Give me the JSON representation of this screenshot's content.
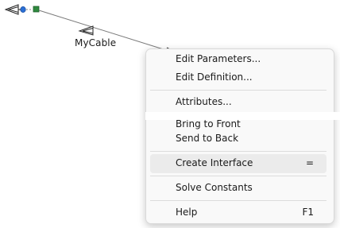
{
  "cable": {
    "label": "MyCable"
  },
  "menu": {
    "items": [
      {
        "label": "Edit Parameters...",
        "shortcut": ""
      },
      {
        "label": "Edit Definition...",
        "shortcut": ""
      },
      {
        "label": "Attributes...",
        "shortcut": ""
      },
      {
        "label": "Bring to Front",
        "shortcut": ""
      },
      {
        "label": "Send to Back",
        "shortcut": ""
      },
      {
        "label": "Create Interface",
        "shortcut": "="
      },
      {
        "label": "Solve Constants",
        "shortcut": ""
      },
      {
        "label": "Help",
        "shortcut": "F1"
      }
    ],
    "highlighted_item": "Create Interface"
  },
  "colors": {
    "menu_background": "#f9f9f9",
    "highlight": "#ebebeb",
    "port_blue": "#2b6fd6",
    "port_green": "#2f8a3e"
  }
}
